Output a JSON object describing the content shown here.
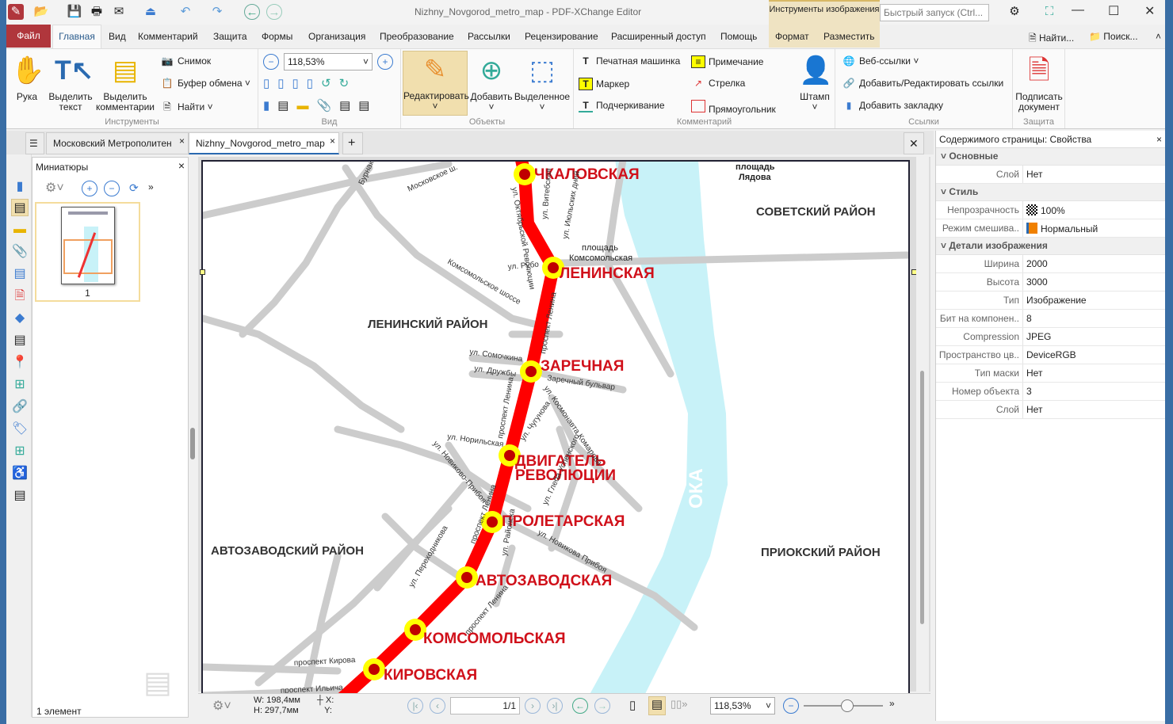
{
  "window": {
    "title": "Nizhny_Novgorod_metro_map - PDF-XChange Editor",
    "context_tab_header": "Инструменты изображения",
    "quick_launch_placeholder": "Быстрый запуск (Ctrl..."
  },
  "menu": {
    "file": "Файл",
    "tabs": [
      "Главная",
      "Вид",
      "Комментарий",
      "Защита",
      "Формы",
      "Организация",
      "Преобразование",
      "Рассылки",
      "Рецензирование",
      "Расширенный доступ",
      "Помощь",
      "Формат",
      "Разместить"
    ],
    "find": "Найти...",
    "search": "Поиск..."
  },
  "ribbon": {
    "tools": {
      "label": "Инструменты",
      "hand": "Рука",
      "select_text": "Выделить текст",
      "select_comments": "Выделить комментарии",
      "snapshot": "Снимок",
      "clipboard": "Буфер обмена",
      "find": "Найти"
    },
    "view": {
      "label": "Вид",
      "zoom": "118,53%"
    },
    "objects": {
      "label": "Объекты",
      "edit": "Редактировать",
      "add": "Добавить",
      "selected": "Выделенное"
    },
    "comments": {
      "label": "Комментарий",
      "typewriter": "Печатная машинка",
      "marker": "Маркер",
      "underline": "Подчеркивание",
      "note": "Примечание",
      "arrow": "Стрелка",
      "rectangle": "Прямоугольник",
      "stamp": "Штамп"
    },
    "links": {
      "label": "Ссылки",
      "web_links": "Веб-ссылки",
      "add_edit_links": "Добавить/Редактировать ссылки",
      "add_bookmark": "Добавить закладку"
    },
    "protect": {
      "label": "Защита",
      "sign": "Подписать документ"
    }
  },
  "doc_tabs": [
    "Московский Метрополитен",
    "Nizhny_Novgorod_metro_map"
  ],
  "thumbnails": {
    "title": "Миниатюры",
    "page": "1"
  },
  "status": "1 элемент",
  "map": {
    "stations": [
      "ЧКАЛОВСКАЯ",
      "ЛЕНИНСКАЯ",
      "ЗАРЕЧНАЯ",
      "ДВИГАТЕЛЬ",
      "РЕВОЛЮЦИИ",
      "ПРОЛЕТАРСКАЯ",
      "АВТОЗАВОДСКАЯ",
      "КОМСОМОЛЬСКАЯ",
      "КИРОВСКАЯ"
    ],
    "districts": [
      "СОВЕТСКИЙ РАЙОН",
      "ЛЕНИНСКИЙ РАЙОН",
      "АВТОЗАВОДСКИЙ РАЙОН",
      "ПРИОКСКИЙ РАЙОН"
    ],
    "places": [
      "площадь",
      "Лядова",
      "площадь",
      "Комсомольская"
    ],
    "river": "ОКА",
    "streets": [
      "Московское ш.",
      "Бурнак.",
      "ул. Октябрьской Революции",
      "ул. Витебская",
      "ул. Июльских дней",
      "ул. Рубо",
      "Комсомольское шоссе",
      "проспект Ленина",
      "ул. Сомочкина",
      "ул. Дружбы",
      "Заречный бульвар",
      "ул. Космонавта Комарова",
      "ул. Чугунова",
      "ул. Норильская",
      "ул. Новиково-Прибоя",
      "ул. Глеба Успенского",
      "ул. Переходникова",
      "ул. Районска",
      "ул. Новикова Прибоя",
      "проспект Кирова",
      "проспект Ильича"
    ],
    "colors": {
      "line": "#ff0000",
      "station": "#c00000",
      "ring": "#ffff00",
      "river": "#c8f2f8",
      "road": "#cccccc"
    }
  },
  "bottom": {
    "width": "W: 198,4мм",
    "height": "H: 297,7мм",
    "x": "X:",
    "y": "Y:",
    "page": "1/1",
    "zoom": "118,53%",
    "zoom_level": 0.55
  },
  "properties": {
    "title": "Содержимого страницы: Свойства",
    "sections": [
      {
        "name": "Основные",
        "rows": [
          [
            "Слой",
            "Нет"
          ]
        ]
      },
      {
        "name": "Стиль",
        "rows": [
          [
            "Непрозрачность",
            "100%"
          ],
          [
            "Режим смешива..",
            "Нормальный"
          ]
        ]
      },
      {
        "name": "Детали изображения",
        "rows": [
          [
            "Ширина",
            "2000"
          ],
          [
            "Высота",
            "3000"
          ],
          [
            "Тип",
            "Изображение"
          ],
          [
            "Бит на компонен..",
            "8"
          ],
          [
            "Compression",
            "JPEG"
          ],
          [
            "Пространство цв..",
            "DeviceRGB"
          ],
          [
            "Тип маски",
            "Нет"
          ],
          [
            "Номер объекта",
            "3"
          ],
          [
            "Слой",
            "Нет"
          ]
        ]
      }
    ]
  }
}
